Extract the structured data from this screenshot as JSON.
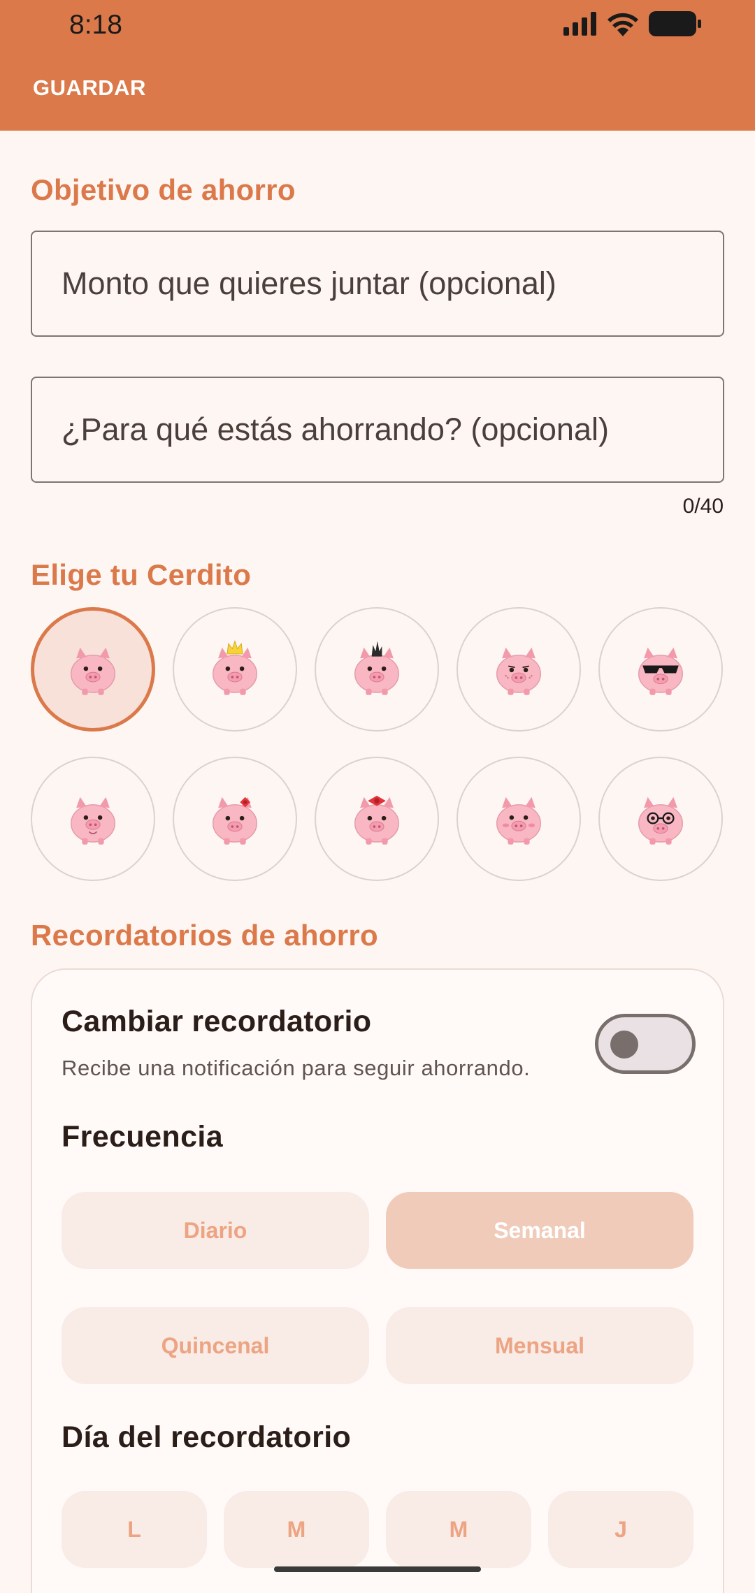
{
  "status_bar": {
    "time": "8:18"
  },
  "toolbar": {
    "save_label": "GUARDAR"
  },
  "goal": {
    "title": "Objetivo de ahorro",
    "amount_placeholder": "Monto que quieres juntar (opcional)",
    "amount_value": "",
    "purpose_placeholder": "¿Para qué estás ahorrando? (opcional)",
    "purpose_value": "",
    "char_counter": "0/40"
  },
  "pig_picker": {
    "title": "Elige tu Cerdito",
    "selected_index": 0,
    "options": [
      "pig-plain-icon",
      "pig-crown-icon",
      "pig-mohawk-icon",
      "pig-freckles-icon",
      "pig-sunglasses-icon",
      "pig-smile-icon",
      "pig-bow-icon",
      "pig-red-bow-icon",
      "pig-blush-icon",
      "pig-glasses-icon"
    ]
  },
  "reminders": {
    "title": "Recordatorios de ahorro",
    "toggle_title": "Cambiar recordatorio",
    "toggle_subtitle": "Recibe una notificación para seguir ahorrando.",
    "toggle_on": false,
    "frequency_title": "Frecuencia",
    "frequencies": [
      {
        "label": "Diario",
        "selected": false
      },
      {
        "label": "Semanal",
        "selected": true
      },
      {
        "label": "Quincenal",
        "selected": false
      },
      {
        "label": "Mensual",
        "selected": false
      }
    ],
    "day_title": "Día del recordatorio",
    "days": [
      "L",
      "M",
      "M",
      "J"
    ]
  },
  "colors": {
    "accent": "#db794a",
    "background": "#fdf6f3",
    "chip_bg": "#f9ebe6",
    "chip_active_bg": "#f1cbb9",
    "pig_pink": "#f8b7c3"
  }
}
